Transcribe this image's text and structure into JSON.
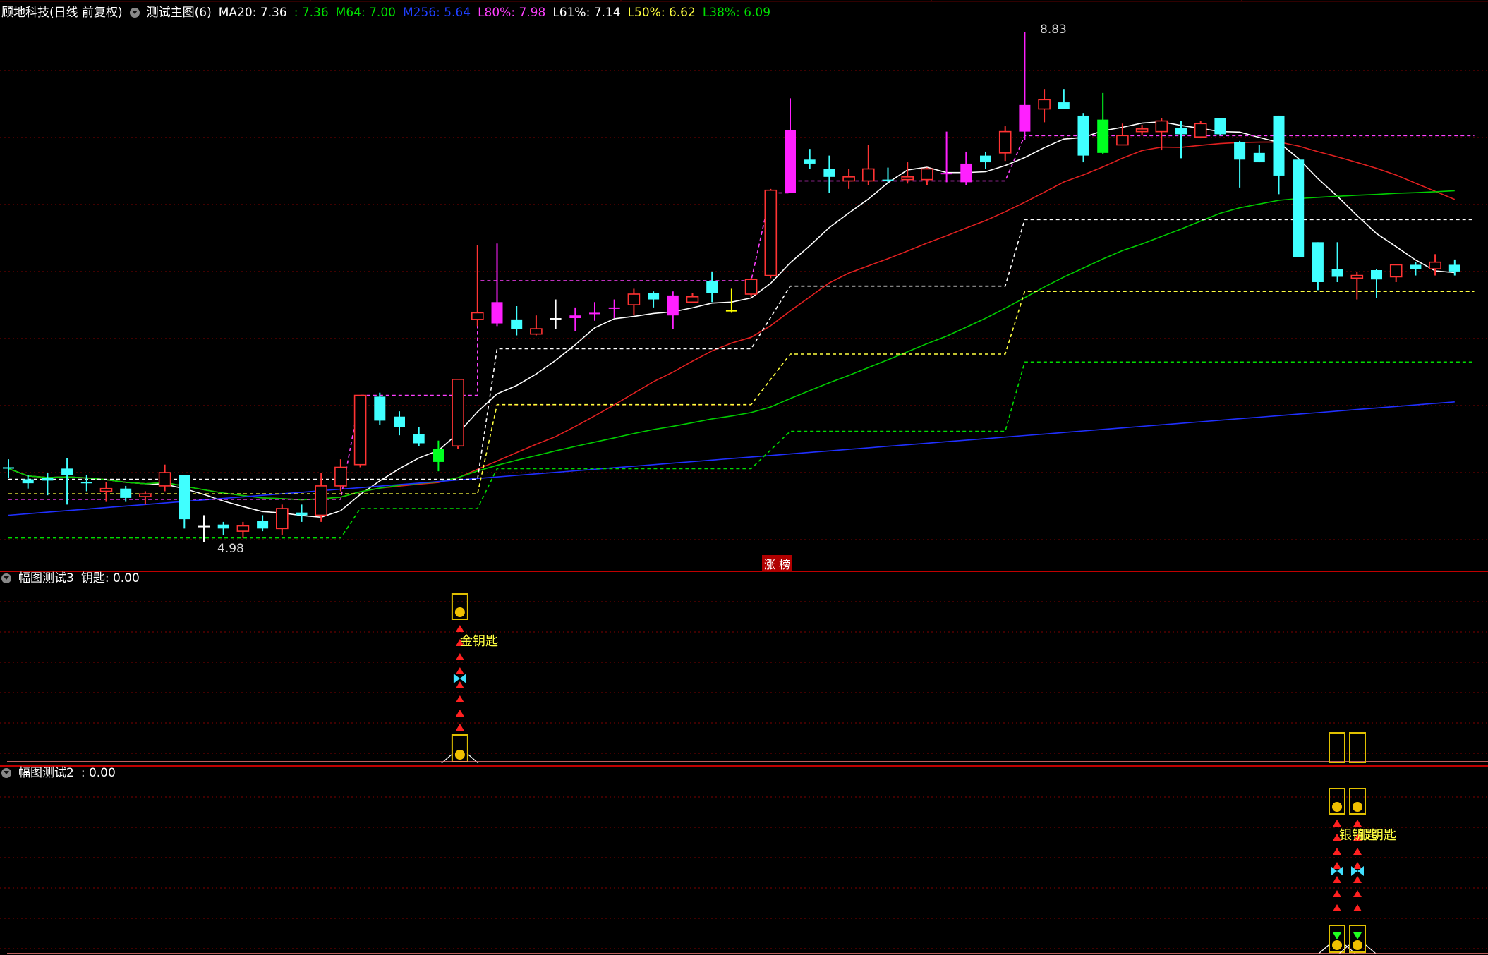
{
  "header": {
    "stock_name": "顾地科技(日线 前复权)",
    "indicator_name": "测试主图(6)",
    "items": [
      {
        "label": "MA20: 7.36",
        "color": "#ffffff"
      },
      {
        "label": ": 7.36",
        "color": "#00e000"
      },
      {
        "label": "M64: 7.00",
        "color": "#00e000"
      },
      {
        "label": "M256: 5.64",
        "color": "#2040ff"
      },
      {
        "label": "L80%: 7.98",
        "color": "#ff40ff"
      },
      {
        "label": "L61%: 7.14",
        "color": "#ffffff"
      },
      {
        "label": "L50%: 6.62",
        "color": "#ffff40"
      },
      {
        "label": "L38%: 6.09",
        "color": "#00e000"
      }
    ]
  },
  "main": {
    "high_label": "8.83",
    "low_label": "4.98",
    "zt_label": "涨 榜"
  },
  "panel2": {
    "title": "幅图测试3",
    "value": "钥匙: 0.00",
    "signal_text": "金钥匙"
  },
  "panel3": {
    "title": "幅图测试2",
    "value": ": 0.00",
    "signal_text": "银钥匙"
  },
  "colors": {
    "up": "#ff3333",
    "down": "#40ffff",
    "ma20": "#ffffff",
    "m64_ma": "#00cc00",
    "m256": "#2030ff",
    "l80": "#ff40ff",
    "l61": "#ffffff",
    "l50": "#ffff40",
    "l38": "#00dd00",
    "grid": "#800000"
  },
  "chart_data": {
    "type": "candlestick",
    "price_high": 8.83,
    "price_low": 4.98,
    "candles": [
      {
        "o": 5.56,
        "h": 5.62,
        "l": 5.48,
        "c": 5.55,
        "clr": "cyan"
      },
      {
        "o": 5.47,
        "h": 5.5,
        "l": 5.4,
        "c": 5.44,
        "clr": "cyan"
      },
      {
        "o": 5.48,
        "h": 5.52,
        "l": 5.35,
        "c": 5.46,
        "clr": "cyan"
      },
      {
        "o": 5.55,
        "h": 5.63,
        "l": 5.28,
        "c": 5.5,
        "clr": "cyan"
      },
      {
        "o": 5.45,
        "h": 5.5,
        "l": 5.38,
        "c": 5.45,
        "clr": "cyan"
      },
      {
        "o": 5.38,
        "h": 5.45,
        "l": 5.3,
        "c": 5.4,
        "clr": "up"
      },
      {
        "o": 5.4,
        "h": 5.42,
        "l": 5.3,
        "c": 5.33,
        "clr": "cyan"
      },
      {
        "o": 5.34,
        "h": 5.38,
        "l": 5.28,
        "c": 5.36,
        "clr": "up"
      },
      {
        "o": 5.42,
        "h": 5.58,
        "l": 5.38,
        "c": 5.52,
        "clr": "up"
      },
      {
        "o": 5.5,
        "h": 5.5,
        "l": 5.1,
        "c": 5.17,
        "clr": "cyan"
      },
      {
        "o": 5.12,
        "h": 5.2,
        "l": 5.0,
        "c": 5.12,
        "clr": "white"
      },
      {
        "o": 5.13,
        "h": 5.15,
        "l": 5.05,
        "c": 5.1,
        "clr": "cyan"
      },
      {
        "o": 5.08,
        "h": 5.15,
        "l": 5.03,
        "c": 5.12,
        "clr": "up"
      },
      {
        "o": 5.16,
        "h": 5.2,
        "l": 5.08,
        "c": 5.1,
        "clr": "cyan"
      },
      {
        "o": 5.1,
        "h": 5.28,
        "l": 5.05,
        "c": 5.25,
        "clr": "up"
      },
      {
        "o": 5.22,
        "h": 5.28,
        "l": 5.15,
        "c": 5.2,
        "clr": "cyan"
      },
      {
        "o": 5.2,
        "h": 5.52,
        "l": 5.15,
        "c": 5.42,
        "clr": "up"
      },
      {
        "o": 5.42,
        "h": 5.62,
        "l": 5.38,
        "c": 5.56,
        "clr": "up"
      },
      {
        "o": 5.58,
        "h": 6.1,
        "l": 5.56,
        "c": 6.1,
        "clr": "up"
      },
      {
        "o": 6.09,
        "h": 6.12,
        "l": 5.88,
        "c": 5.91,
        "clr": "cyan"
      },
      {
        "o": 5.94,
        "h": 5.98,
        "l": 5.8,
        "c": 5.86,
        "clr": "cyan"
      },
      {
        "o": 5.81,
        "h": 5.86,
        "l": 5.72,
        "c": 5.74,
        "clr": "cyan"
      },
      {
        "o": 5.6,
        "h": 5.76,
        "l": 5.53,
        "c": 5.7,
        "clr": "green"
      },
      {
        "o": 5.72,
        "h": 6.22,
        "l": 5.7,
        "c": 6.22,
        "clr": "up"
      },
      {
        "o": 6.67,
        "h": 7.23,
        "l": 6.62,
        "c": 6.72,
        "clr": "up"
      },
      {
        "o": 6.8,
        "h": 7.24,
        "l": 6.62,
        "c": 6.64,
        "clr": "magenta"
      },
      {
        "o": 6.67,
        "h": 6.77,
        "l": 6.55,
        "c": 6.6,
        "clr": "cyan"
      },
      {
        "o": 6.56,
        "h": 6.7,
        "l": 6.55,
        "c": 6.6,
        "clr": "up"
      },
      {
        "o": 6.68,
        "h": 6.82,
        "l": 6.6,
        "c": 6.68,
        "clr": "white"
      },
      {
        "o": 6.7,
        "h": 6.76,
        "l": 6.58,
        "c": 6.68,
        "clr": "magenta"
      },
      {
        "o": 6.72,
        "h": 6.8,
        "l": 6.66,
        "c": 6.72,
        "clr": "magenta"
      },
      {
        "o": 6.76,
        "h": 6.82,
        "l": 6.68,
        "c": 6.76,
        "clr": "magenta"
      },
      {
        "o": 6.78,
        "h": 6.9,
        "l": 6.7,
        "c": 6.86,
        "clr": "up"
      },
      {
        "o": 6.87,
        "h": 6.88,
        "l": 6.76,
        "c": 6.82,
        "clr": "cyan"
      },
      {
        "o": 6.85,
        "h": 6.88,
        "l": 6.6,
        "c": 6.7,
        "clr": "magenta"
      },
      {
        "o": 6.8,
        "h": 6.87,
        "l": 6.8,
        "c": 6.84,
        "clr": "up"
      },
      {
        "o": 6.87,
        "h": 7.03,
        "l": 6.8,
        "c": 6.96,
        "clr": "cyan"
      },
      {
        "o": 6.74,
        "h": 6.9,
        "l": 6.72,
        "c": 6.74,
        "clr": "yellow"
      },
      {
        "o": 6.86,
        "h": 6.98,
        "l": 6.84,
        "c": 6.97,
        "clr": "up"
      },
      {
        "o": 7.0,
        "h": 7.65,
        "l": 6.98,
        "c": 7.64,
        "clr": "up"
      },
      {
        "o": 7.62,
        "h": 8.33,
        "l": 7.62,
        "c": 8.09,
        "clr": "magenta"
      },
      {
        "o": 7.87,
        "h": 7.95,
        "l": 7.8,
        "c": 7.84,
        "clr": "cyan"
      },
      {
        "o": 7.74,
        "h": 7.9,
        "l": 7.62,
        "c": 7.8,
        "clr": "cyan"
      },
      {
        "o": 7.74,
        "h": 7.8,
        "l": 7.65,
        "c": 7.71,
        "clr": "up"
      },
      {
        "o": 7.71,
        "h": 7.98,
        "l": 7.68,
        "c": 7.8,
        "clr": "up"
      },
      {
        "o": 7.71,
        "h": 7.81,
        "l": 7.7,
        "c": 7.72,
        "clr": "cyan"
      },
      {
        "o": 7.72,
        "h": 7.85,
        "l": 7.69,
        "c": 7.74,
        "clr": "up"
      },
      {
        "o": 7.72,
        "h": 7.81,
        "l": 7.68,
        "c": 7.8,
        "clr": "up"
      },
      {
        "o": 7.76,
        "h": 8.08,
        "l": 7.7,
        "c": 7.77,
        "clr": "magenta"
      },
      {
        "o": 7.7,
        "h": 7.93,
        "l": 7.68,
        "c": 7.84,
        "clr": "magenta"
      },
      {
        "o": 7.9,
        "h": 7.93,
        "l": 7.8,
        "c": 7.85,
        "clr": "cyan"
      },
      {
        "o": 7.92,
        "h": 8.12,
        "l": 7.86,
        "c": 8.08,
        "clr": "up"
      },
      {
        "o": 8.08,
        "h": 8.83,
        "l": 8.02,
        "c": 8.28,
        "clr": "magenta"
      },
      {
        "o": 8.25,
        "h": 8.4,
        "l": 8.15,
        "c": 8.32,
        "clr": "up"
      },
      {
        "o": 8.3,
        "h": 8.4,
        "l": 8.25,
        "c": 8.25,
        "clr": "cyan"
      },
      {
        "o": 8.2,
        "h": 8.22,
        "l": 7.85,
        "c": 7.9,
        "clr": "cyan"
      },
      {
        "o": 7.92,
        "h": 8.37,
        "l": 7.91,
        "c": 8.17,
        "clr": "green"
      },
      {
        "o": 7.98,
        "h": 8.14,
        "l": 7.98,
        "c": 8.05,
        "clr": "up"
      },
      {
        "o": 8.08,
        "h": 8.13,
        "l": 8.05,
        "c": 8.1,
        "clr": "up"
      },
      {
        "o": 8.08,
        "h": 8.18,
        "l": 7.94,
        "c": 8.16,
        "clr": "up"
      },
      {
        "o": 8.11,
        "h": 8.16,
        "l": 7.88,
        "c": 8.06,
        "clr": "cyan"
      },
      {
        "o": 8.04,
        "h": 8.16,
        "l": 8.03,
        "c": 8.14,
        "clr": "up"
      },
      {
        "o": 8.18,
        "h": 8.18,
        "l": 8.05,
        "c": 8.06,
        "clr": "cyan"
      },
      {
        "o": 8.0,
        "h": 8.01,
        "l": 7.66,
        "c": 7.87,
        "clr": "cyan"
      },
      {
        "o": 7.92,
        "h": 7.98,
        "l": 7.85,
        "c": 7.85,
        "clr": "cyan"
      },
      {
        "o": 8.2,
        "h": 8.2,
        "l": 7.61,
        "c": 7.75,
        "clr": "cyan"
      },
      {
        "o": 7.87,
        "h": 7.87,
        "l": 7.14,
        "c": 7.14,
        "clr": "cyan"
      },
      {
        "o": 7.25,
        "h": 7.25,
        "l": 6.89,
        "c": 6.95,
        "clr": "cyan"
      },
      {
        "o": 7.05,
        "h": 7.25,
        "l": 6.95,
        "c": 6.99,
        "clr": "cyan"
      },
      {
        "o": 6.98,
        "h": 7.03,
        "l": 6.82,
        "c": 7.0,
        "clr": "up"
      },
      {
        "o": 7.04,
        "h": 7.05,
        "l": 6.83,
        "c": 6.97,
        "clr": "cyan"
      },
      {
        "o": 6.99,
        "h": 7.08,
        "l": 6.95,
        "c": 7.08,
        "clr": "up"
      },
      {
        "o": 7.08,
        "h": 7.1,
        "l": 7.0,
        "c": 7.05,
        "clr": "cyan"
      },
      {
        "o": 7.05,
        "h": 7.16,
        "l": 7.0,
        "c": 7.1,
        "clr": "up"
      },
      {
        "o": 7.08,
        "h": 7.12,
        "l": 7.0,
        "c": 7.03,
        "clr": "cyan"
      }
    ]
  }
}
